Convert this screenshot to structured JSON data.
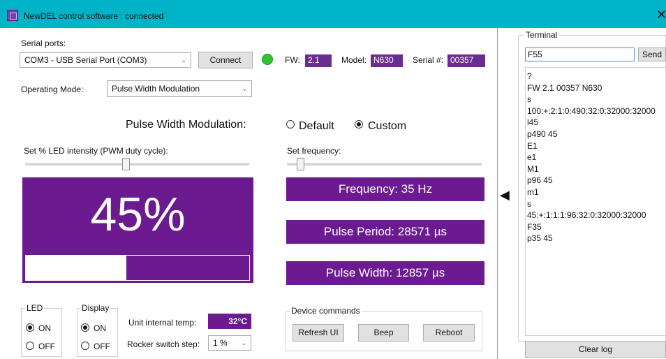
{
  "window": {
    "title": "NewDEL control software : connected"
  },
  "serial": {
    "label": "Serial ports:",
    "port_value": "COM3 - USB Serial Port (COM3)",
    "connect_label": "Connect",
    "fw_label": "FW:",
    "fw_value": "2.1",
    "model_label": "Model:",
    "model_value": "N630",
    "serial_label": "Serial #:",
    "serial_value": "00357",
    "status_color": "#2ec432"
  },
  "mode": {
    "label": "Operating Mode:",
    "value": "Pulse Width Modulation"
  },
  "pwm": {
    "heading": "Pulse Width Modulation:",
    "option_default": "Default",
    "option_custom": "Custom",
    "selected": "Custom",
    "intensity_label": "Set % LED intensity (PWM duty cycle):",
    "frequency_label": "Set frequency:",
    "intensity_display": "45%",
    "intensity_value": 45,
    "frequency_display": "Frequency: 35 Hz",
    "period_display": "Pulse Period: 28571 µs",
    "width_display": "Pulse Width: 12857 µs",
    "accent_color": "#6b1a8f"
  },
  "led": {
    "title": "LED",
    "on_label": "ON",
    "off_label": "OFF",
    "selected": "ON"
  },
  "display": {
    "title": "Display",
    "on_label": "ON",
    "off_label": "OFF",
    "selected": "ON"
  },
  "unit": {
    "temp_label": "Unit internal temp:",
    "temp_value": "32°C",
    "rocker_label": "Rocker switch step:",
    "rocker_value": "1 %"
  },
  "device_commands": {
    "title": "Device commands",
    "refresh_label": "Refresh UI",
    "beep_label": "Beep",
    "reboot_label": "Reboot"
  },
  "terminal": {
    "title": "Terminal",
    "input_value": "F55",
    "send_label": "Send",
    "clear_label": "Clear log",
    "log": [
      "?",
      "FW 2.1 00357 N630",
      "s",
      "100:+:2:1:0:490:32:0:32000:32000",
      "l45",
      "p490 45",
      "E1",
      "e1",
      "M1",
      "p96 45",
      "m1",
      "s",
      "45:+:1:1:1:96:32:0:32000:32000",
      "F35",
      "p35 45"
    ]
  }
}
